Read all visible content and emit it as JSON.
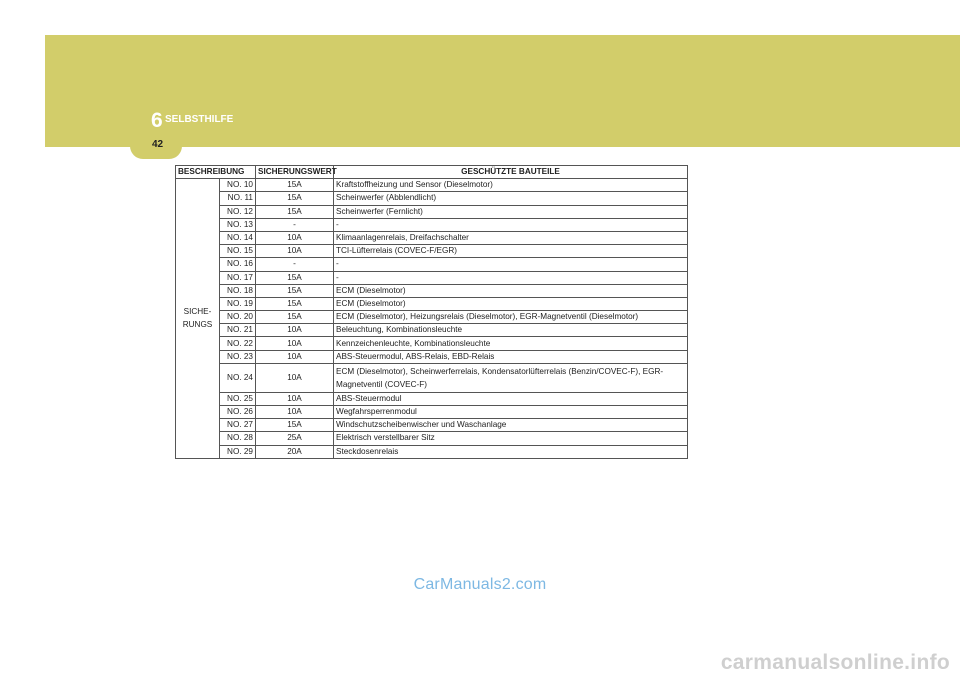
{
  "header": {
    "chapter_number": "6",
    "chapter_title": "SELBSTHILFE",
    "page_number": "42",
    "band_color": "#d2cd6a"
  },
  "table": {
    "headers": {
      "description": "BESCHREIBUNG",
      "rating": "SICHERUNGSWERT",
      "components": "GESCHÜTZTE BAUTEILE"
    },
    "description_value_line1": "SICHE-",
    "description_value_line2": "RUNGS",
    "rows": [
      {
        "no": "NO. 10",
        "value": "15A",
        "components": "Kraftstoffheizung und Sensor (Dieselmotor)"
      },
      {
        "no": "NO. 11",
        "value": "15A",
        "components": "Scheinwerfer (Abblendlicht)"
      },
      {
        "no": "NO. 12",
        "value": "15A",
        "components": "Scheinwerfer (Fernlicht)"
      },
      {
        "no": "NO. 13",
        "value": "-",
        "components": "-"
      },
      {
        "no": "NO. 14",
        "value": "10A",
        "components": "Klimaanlagenrelais, Dreifachschalter"
      },
      {
        "no": "NO. 15",
        "value": "10A",
        "components": "TCI-Lüfterrelais (COVEC-F/EGR)"
      },
      {
        "no": "NO. 16",
        "value": "-",
        "components": "-"
      },
      {
        "no": "NO. 17",
        "value": "15A",
        "components": "-"
      },
      {
        "no": "NO. 18",
        "value": "15A",
        "components": "ECM (Dieselmotor)"
      },
      {
        "no": "NO. 19",
        "value": "15A",
        "components": "ECM (Dieselmotor)"
      },
      {
        "no": "NO. 20",
        "value": "15A",
        "components": "ECM (Dieselmotor), Heizungsrelais (Dieselmotor), EGR-Magnetventil (Dieselmotor)"
      },
      {
        "no": "NO. 21",
        "value": "10A",
        "components": "Beleuchtung, Kombinationsleuchte"
      },
      {
        "no": "NO. 22",
        "value": "10A",
        "components": "Kennzeichenleuchte, Kombinationsleuchte"
      },
      {
        "no": "NO. 23",
        "value": "10A",
        "components": "ABS-Steuermodul, ABS-Relais, EBD-Relais"
      },
      {
        "no": "NO. 24",
        "value": "10A",
        "components": "ECM (Dieselmotor), Scheinwerferrelais, Kondensatorlüfterrelais (Benzin/COVEC-F), EGR-Magnetventil (COVEC-F)"
      },
      {
        "no": "NO. 25",
        "value": "10A",
        "components": "ABS-Steuermodul"
      },
      {
        "no": "NO. 26",
        "value": "10A",
        "components": "Wegfahrsperrenmodul"
      },
      {
        "no": "NO. 27",
        "value": "15A",
        "components": "Windschutzscheibenwischer und Waschanlage"
      },
      {
        "no": "NO. 28",
        "value": "25A",
        "components": "Elektrisch verstellbarer Sitz"
      },
      {
        "no": "NO. 29",
        "value": "20A",
        "components": "Steckdosenrelais"
      }
    ]
  },
  "watermarks": {
    "primary": "CarManuals2.com",
    "secondary": "carmanualsonline.info"
  }
}
